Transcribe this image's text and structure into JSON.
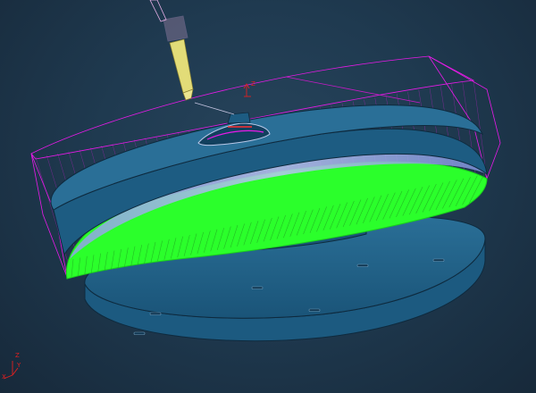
{
  "viewport": {
    "background": "#1f3a50",
    "colors": {
      "part_body": "#1e5f86",
      "part_edge": "#0e2a3e",
      "toolpath_outer": "#e81ae8",
      "toolpath_inner": "#2bff2b",
      "toolpath_shading": "#9aa0e8",
      "tool_holder": "#e8e080",
      "triad": "#e02020"
    }
  },
  "workplane_triad": {
    "z_label": "Z",
    "x_label": "X",
    "y_label": "Y"
  },
  "tool_triad": {
    "z_label": "Z"
  }
}
